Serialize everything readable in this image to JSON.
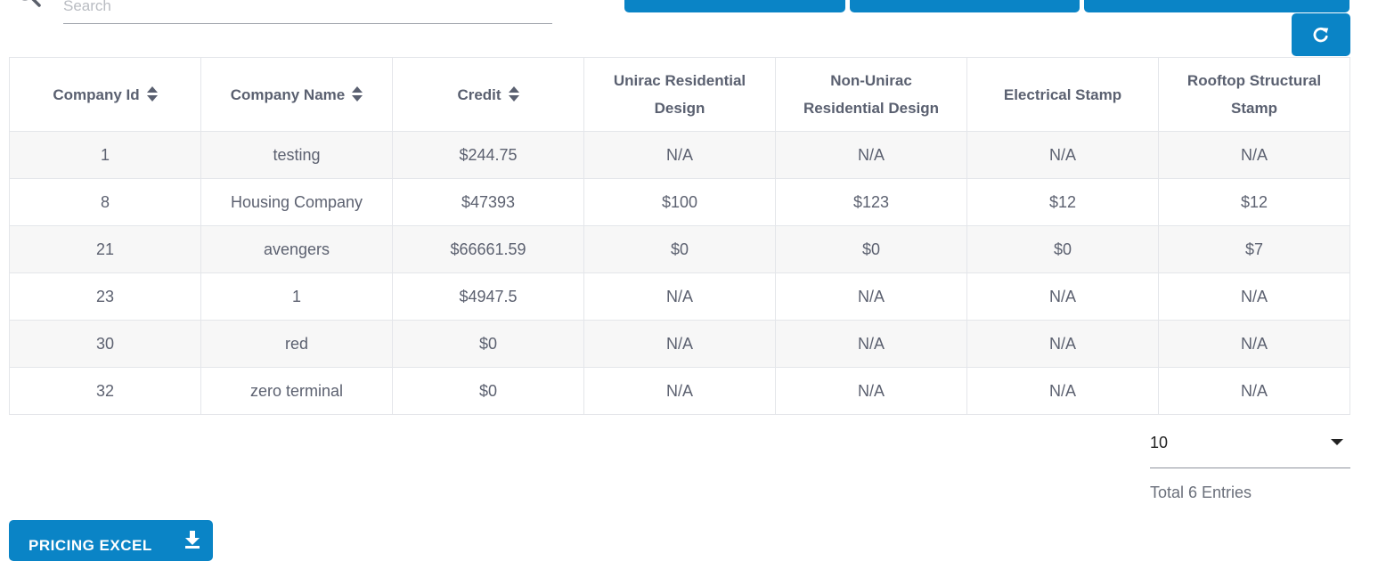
{
  "search": {
    "placeholder": "Search",
    "value": ""
  },
  "top_buttons": [
    "",
    "",
    ""
  ],
  "table": {
    "columns": [
      {
        "label": "Company Id",
        "sortable": true
      },
      {
        "label": "Company Name",
        "sortable": true
      },
      {
        "label": "Credit",
        "sortable": true
      },
      {
        "label": "Unirac Residential Design",
        "sortable": false
      },
      {
        "label": "Non-Unirac Residential Design",
        "sortable": false
      },
      {
        "label": "Electrical Stamp",
        "sortable": false
      },
      {
        "label": "Rooftop Structural Stamp",
        "sortable": false
      }
    ],
    "rows": [
      [
        "1",
        "testing",
        "$244.75",
        "N/A",
        "N/A",
        "N/A",
        "N/A"
      ],
      [
        "8",
        "Housing Company",
        "$47393",
        "$100",
        "$123",
        "$12",
        "$12"
      ],
      [
        "21",
        "avengers",
        "$66661.59",
        "$0",
        "$0",
        "$0",
        "$7"
      ],
      [
        "23",
        "1",
        "$4947.5",
        "N/A",
        "N/A",
        "N/A",
        "N/A"
      ],
      [
        "30",
        "red",
        "$0",
        "N/A",
        "N/A",
        "N/A",
        "N/A"
      ],
      [
        "32",
        "zero terminal",
        "$0",
        "N/A",
        "N/A",
        "N/A",
        "N/A"
      ]
    ]
  },
  "pagination": {
    "page_size": "10",
    "total": "Total 6 Entries"
  },
  "excel_button": {
    "label": "PRICING EXCEL"
  },
  "icons": {
    "search": "search-icon",
    "refresh": "refresh-icon",
    "sort": "sort-icon",
    "caret": "caret-down-icon",
    "download": "download-icon"
  },
  "colors": {
    "primary": "#0a84c6",
    "stripe": "#f7f7f7",
    "border": "#e4e6ea",
    "text": "#5c6170"
  }
}
